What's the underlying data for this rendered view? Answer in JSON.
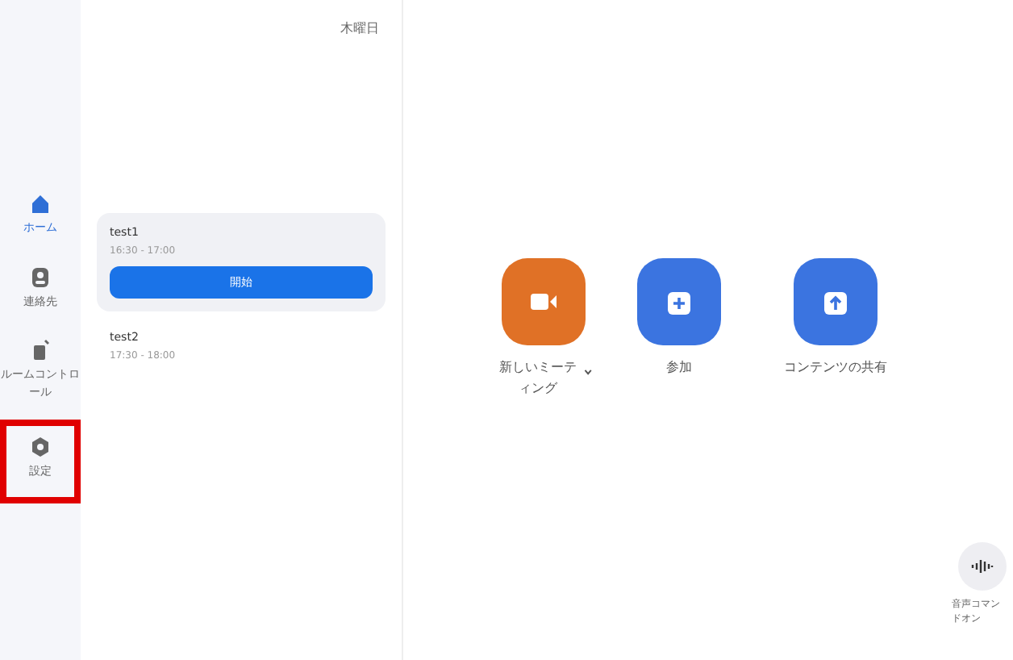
{
  "sidebar": {
    "items": [
      {
        "label": "ホーム",
        "kind": "home",
        "selected": true,
        "highlighted": false
      },
      {
        "label": "連絡先",
        "kind": "contacts",
        "selected": false,
        "highlighted": false
      },
      {
        "label": "ルームコントロール",
        "kind": "room",
        "selected": false,
        "highlighted": false
      },
      {
        "label": "設定",
        "kind": "settings",
        "selected": false,
        "highlighted": true
      }
    ]
  },
  "meetings_panel": {
    "header": {
      "weekday": "木曜日"
    },
    "meetings": [
      {
        "title": "test1",
        "time": "16:30 - 17:00",
        "selected": true,
        "button": "開始"
      },
      {
        "title": "test2",
        "time": "17:30 - 18:00",
        "selected": false
      }
    ]
  },
  "actions": [
    {
      "label": "新しいミーティング",
      "kind": "new",
      "color": "#e07126",
      "has_menu": true
    },
    {
      "label": "参加",
      "kind": "join",
      "color": "#3b74e0",
      "has_menu": false
    },
    {
      "label": "コンテンツの共有",
      "kind": "share",
      "color": "#3b74e0",
      "has_menu": false
    }
  ],
  "voice_command": {
    "lines": [
      "音声コマン",
      "ドオン"
    ]
  }
}
